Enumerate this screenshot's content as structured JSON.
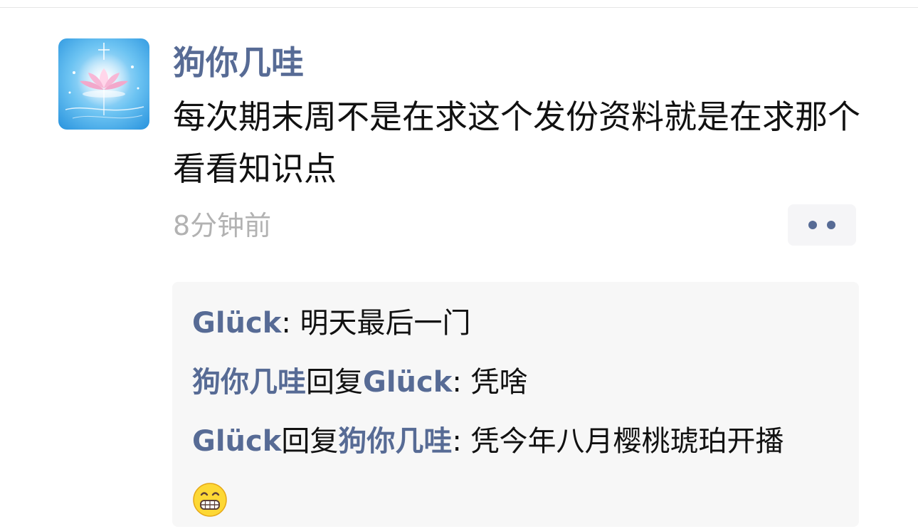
{
  "post": {
    "author": "狗你几哇",
    "text": "每次期末周不是在求这个发份资料就是在求那个看看知识点",
    "time": "8分钟前",
    "avatar_icon": "lotus-avatar-icon",
    "more_icon": "more-dots-icon"
  },
  "comments": [
    {
      "from": "Glück",
      "separator": ": ",
      "text": "明天最后一门"
    },
    {
      "from": "狗你几哇",
      "reply_word": "回复",
      "to": "Glück",
      "separator": ": ",
      "text": "凭啥"
    },
    {
      "from": "Glück",
      "reply_word": "回复",
      "to": "狗你几哇",
      "separator": ": ",
      "text": "凭今年八月樱桃琥珀开播",
      "emoji": "grinning-teeth-emoji"
    }
  ],
  "colors": {
    "name_link": "#576b95",
    "timestamp": "#b2b2b2",
    "comment_bg": "#f7f7f7"
  }
}
